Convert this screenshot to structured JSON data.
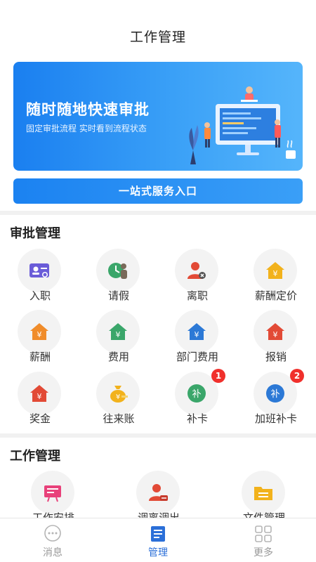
{
  "header": {
    "title": "工作管理"
  },
  "banner": {
    "title": "随时随地快速审批",
    "subtitle": "固定审批流程  实时看到流程状态"
  },
  "service_button": {
    "label": "一站式服务入口"
  },
  "approval": {
    "title": "审批管理",
    "items": [
      {
        "label": "入职",
        "icon": "id-card-icon",
        "color": "#6a5cd8"
      },
      {
        "label": "请假",
        "icon": "leave-clock-icon",
        "color": "#3aa66a"
      },
      {
        "label": "离职",
        "icon": "resign-user-icon",
        "color": "#e24a36"
      },
      {
        "label": "薪酬定价",
        "icon": "salary-house-icon",
        "color": "#f2b21c"
      },
      {
        "label": "薪酬",
        "icon": "salary-house-icon",
        "color": "#f08c2a"
      },
      {
        "label": "费用",
        "icon": "expense-house-icon",
        "color": "#3aa66a"
      },
      {
        "label": "部门费用",
        "icon": "dept-expense-icon",
        "color": "#2c79d6"
      },
      {
        "label": "报销",
        "icon": "reimburse-house-icon",
        "color": "#e24a36"
      },
      {
        "label": "奖金",
        "icon": "bonus-house-icon",
        "color": "#e24a36"
      },
      {
        "label": "往来账",
        "icon": "money-bag-icon",
        "color": "#f2b21c"
      },
      {
        "label": "补卡",
        "icon": "punch-card-icon",
        "color": "#3aa66a",
        "badge": "1"
      },
      {
        "label": "加班补卡",
        "icon": "overtime-card-icon",
        "color": "#2c79d6",
        "badge": "2"
      }
    ]
  },
  "work": {
    "title": "工作管理",
    "items": [
      {
        "label": "工作安排",
        "icon": "work-plan-icon",
        "color": "#e8417a"
      },
      {
        "label": "调离调出",
        "icon": "transfer-user-icon",
        "color": "#e24a36"
      },
      {
        "label": "文件管理",
        "icon": "folder-icon",
        "color": "#f2b21c"
      }
    ]
  },
  "nav": {
    "items": [
      {
        "label": "消息",
        "icon": "chat-bubble-icon",
        "active": false
      },
      {
        "label": "管理",
        "icon": "document-list-icon",
        "active": true
      },
      {
        "label": "更多",
        "icon": "grid-apps-icon",
        "active": false
      }
    ],
    "active_color": "#2b6fd8",
    "inactive_color": "#999999"
  }
}
